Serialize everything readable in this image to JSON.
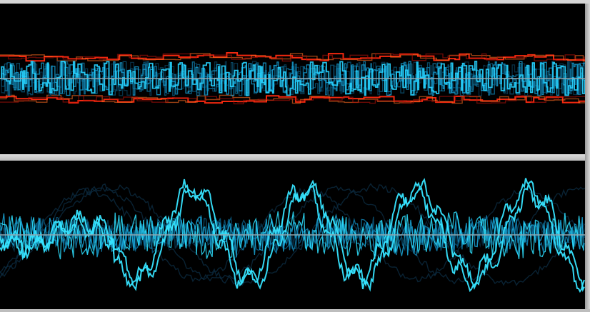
{
  "scope": {
    "background": "#000000",
    "frame_color": "#c8c8c8",
    "baseline_color": "#8fa6b0",
    "top_panel": {
      "envelope_colors": [
        "#ff2a10",
        "#ff6a20",
        "#b01008"
      ],
      "trace_colors": [
        "#27d3ff",
        "#1596c8",
        "#0d6f98",
        "#0a4d6a",
        "#08334a"
      ]
    },
    "bottom_panel": {
      "trace_colors": [
        "#2ee0ff",
        "#1aa7d8",
        "#1080b0",
        "#0b5c82",
        "#083a54",
        "#0a2436"
      ]
    }
  }
}
